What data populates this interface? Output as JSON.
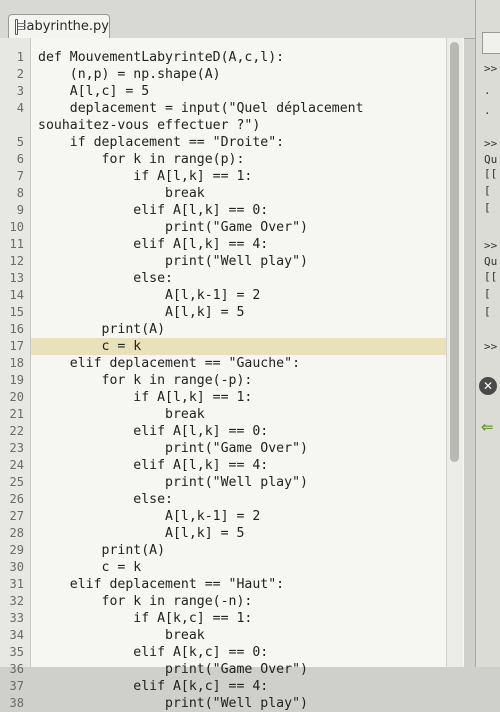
{
  "tab": {
    "file_name": "labyrinthe.py"
  },
  "editor": {
    "lines": [
      {
        "n": "1",
        "text": "def MouvementLabyrinteD(A,c,l):"
      },
      {
        "n": "2",
        "text": "    (n,p) = np.shape(A)"
      },
      {
        "n": "3",
        "text": "    A[l,c] = 5"
      },
      {
        "n": "4",
        "text": "    deplacement = input(\"Quel déplacement"
      },
      {
        "n": "",
        "text": "souhaitez-vous effectuer ?\")"
      },
      {
        "n": "5",
        "text": "    if deplacement == \"Droite\":"
      },
      {
        "n": "6",
        "text": "        for k in range(p):"
      },
      {
        "n": "7",
        "text": "            if A[l,k] == 1:"
      },
      {
        "n": "8",
        "text": "                break"
      },
      {
        "n": "9",
        "text": "            elif A[l,k] == 0:"
      },
      {
        "n": "10",
        "text": "                print(\"Game Over\")"
      },
      {
        "n": "11",
        "text": "            elif A[l,k] == 4:"
      },
      {
        "n": "12",
        "text": "                print(\"Well play\")"
      },
      {
        "n": "13",
        "text": "            else:"
      },
      {
        "n": "14",
        "text": "                A[l,k-1] = 2"
      },
      {
        "n": "15",
        "text": "                A[l,k] = 5"
      },
      {
        "n": "16",
        "text": "        print(A)"
      },
      {
        "n": "17",
        "text": "        c = k"
      },
      {
        "n": "18",
        "text": "    elif deplacement == \"Gauche\":"
      },
      {
        "n": "19",
        "text": "        for k in range(-p):"
      },
      {
        "n": "20",
        "text": "            if A[l,k] == 1:"
      },
      {
        "n": "21",
        "text": "                break"
      },
      {
        "n": "22",
        "text": "            elif A[l,k] == 0:"
      },
      {
        "n": "23",
        "text": "                print(\"Game Over\")"
      },
      {
        "n": "24",
        "text": "            elif A[l,k] == 4:"
      },
      {
        "n": "25",
        "text": "                print(\"Well play\")"
      },
      {
        "n": "26",
        "text": "            else:"
      },
      {
        "n": "27",
        "text": "                A[l,k-1] = 2"
      },
      {
        "n": "28",
        "text": "                A[l,k] = 5"
      },
      {
        "n": "29",
        "text": "        print(A)"
      },
      {
        "n": "30",
        "text": "        c = k"
      },
      {
        "n": "31",
        "text": "    elif deplacement == \"Haut\":"
      },
      {
        "n": "32",
        "text": "        for k in range(-n):"
      },
      {
        "n": "33",
        "text": "            if A[k,c] == 1:"
      },
      {
        "n": "34",
        "text": "                break"
      },
      {
        "n": "35",
        "text": "            elif A[k,c] == 0:"
      },
      {
        "n": "36",
        "text": "                print(\"Game Over\")"
      },
      {
        "n": "37",
        "text": "            elif A[k,c] == 4:"
      },
      {
        "n": "38",
        "text": "                print(\"Well play\")"
      }
    ],
    "current_line": "17"
  },
  "console": {
    "fragments": [
      ">>",
      ".",
      ".",
      ">>",
      "Qu",
      "[[",
      "[",
      "[",
      ">>",
      "Qu",
      "[[",
      "[",
      "[",
      ">>"
    ]
  },
  "icons": {
    "close": "close-icon",
    "arrow": "arrow-left-icon"
  }
}
